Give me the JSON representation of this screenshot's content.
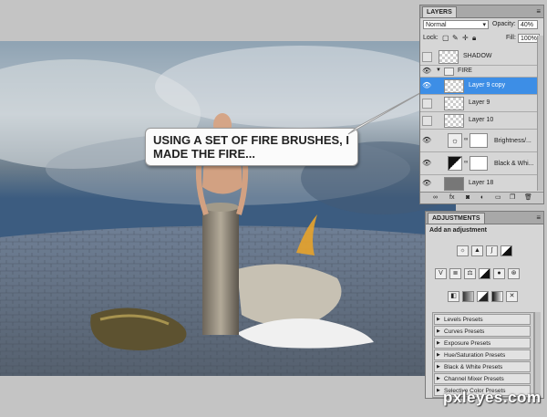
{
  "callout": {
    "line1": "USING A SET OF FIRE BRUSHES, I",
    "line2": "MADE THE FIRE..."
  },
  "layers_panel": {
    "tab": "LAYERS",
    "blend_mode": "Normal",
    "opacity_label": "Opacity:",
    "opacity_value": "40%",
    "lock_label": "Lock:",
    "fill_label": "Fill:",
    "fill_value": "100%",
    "layers": [
      {
        "name": "SHADOW",
        "visible": false,
        "selected": false
      },
      {
        "name": "FIRE",
        "visible": true,
        "selected": false,
        "group": true
      },
      {
        "name": "Layer 9 copy",
        "visible": true,
        "selected": true
      },
      {
        "name": "Layer 9",
        "visible": false,
        "selected": false
      },
      {
        "name": "Layer 10",
        "visible": false,
        "selected": false
      },
      {
        "name": "Brightness/...",
        "visible": true,
        "selected": false
      },
      {
        "name": "Black & Whi...",
        "visible": true,
        "selected": false
      },
      {
        "name": "Layer 18",
        "visible": true,
        "selected": false
      }
    ]
  },
  "adjustments_panel": {
    "tab": "ADJUSTMENTS",
    "heading": "Add an adjustment",
    "presets": [
      "Levels Presets",
      "Curves Presets",
      "Exposure Presets",
      "Hue/Saturation Presets",
      "Black & White Presets",
      "Channel Mixer Presets",
      "Selective Color Presets"
    ]
  },
  "watermark": "pxleyes.com",
  "colors": {
    "selection": "#3d8ee6",
    "panel": "#d6d6d6"
  }
}
